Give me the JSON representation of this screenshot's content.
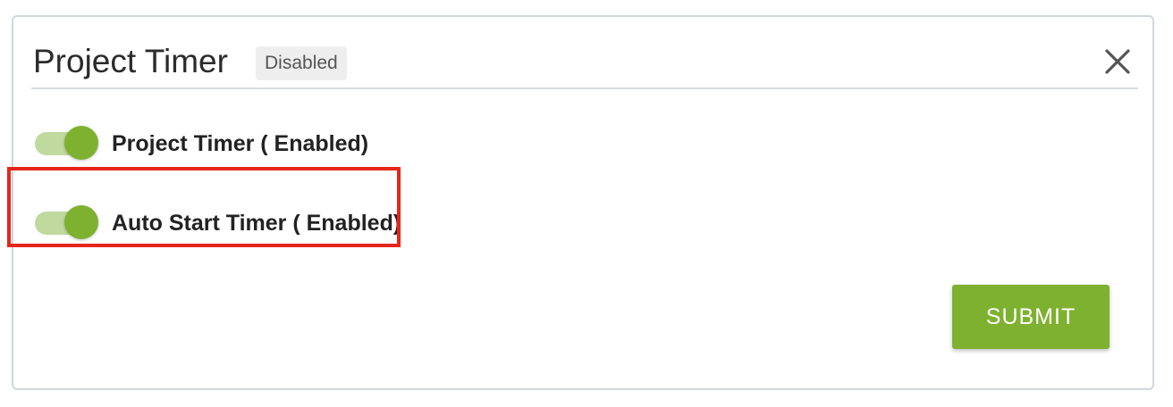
{
  "dialog": {
    "title": "Project Timer",
    "status_badge": "Disabled",
    "close_icon": "close-icon"
  },
  "toggles": [
    {
      "label": "Project Timer ( Enabled)",
      "checked": true
    },
    {
      "label": "Auto Start Timer ( Enabled)",
      "checked": true
    }
  ],
  "actions": {
    "submit_label": "SUBMIT"
  },
  "colors": {
    "accent": "#7eb12f",
    "toggle_track": "#c0d99f",
    "highlight": "#e5261a",
    "badge_bg": "#eeeeee"
  }
}
